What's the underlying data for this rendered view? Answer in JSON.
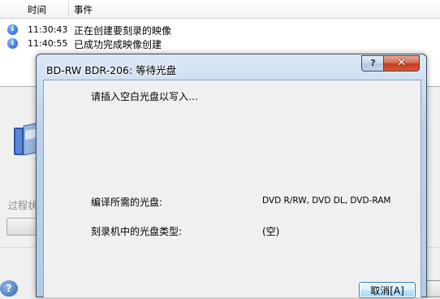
{
  "log": {
    "columns": {
      "time": "时间",
      "event": "事件"
    },
    "rows": [
      {
        "time": "11:30:43",
        "event": "正在创建要刻录的映像"
      },
      {
        "time": "11:40:55",
        "event": "已成功完成映像创建"
      }
    ]
  },
  "background": {
    "progress_label": "过程状"
  },
  "dialog": {
    "title": "BD-RW   BDR-206: 等待光盘",
    "help_glyph": "?",
    "close_glyph": "✕",
    "prompt": "请插入空白光盘以写入…",
    "required_label": "编译所需的光盘:",
    "required_value": "DVD R/RW, DVD DL, DVD-RAM",
    "drive_label": "刻录机中的光盘类型:",
    "drive_value": "(空)",
    "cancel_label": "取消[A]"
  },
  "colors": {
    "dialog_frame": "#c4d7ed",
    "close_button": "#c13b1d",
    "info_icon": "#1b5bcf"
  },
  "icons": [
    "info-icon",
    "disc-burner-icon",
    "help-icon",
    "close-icon"
  ]
}
